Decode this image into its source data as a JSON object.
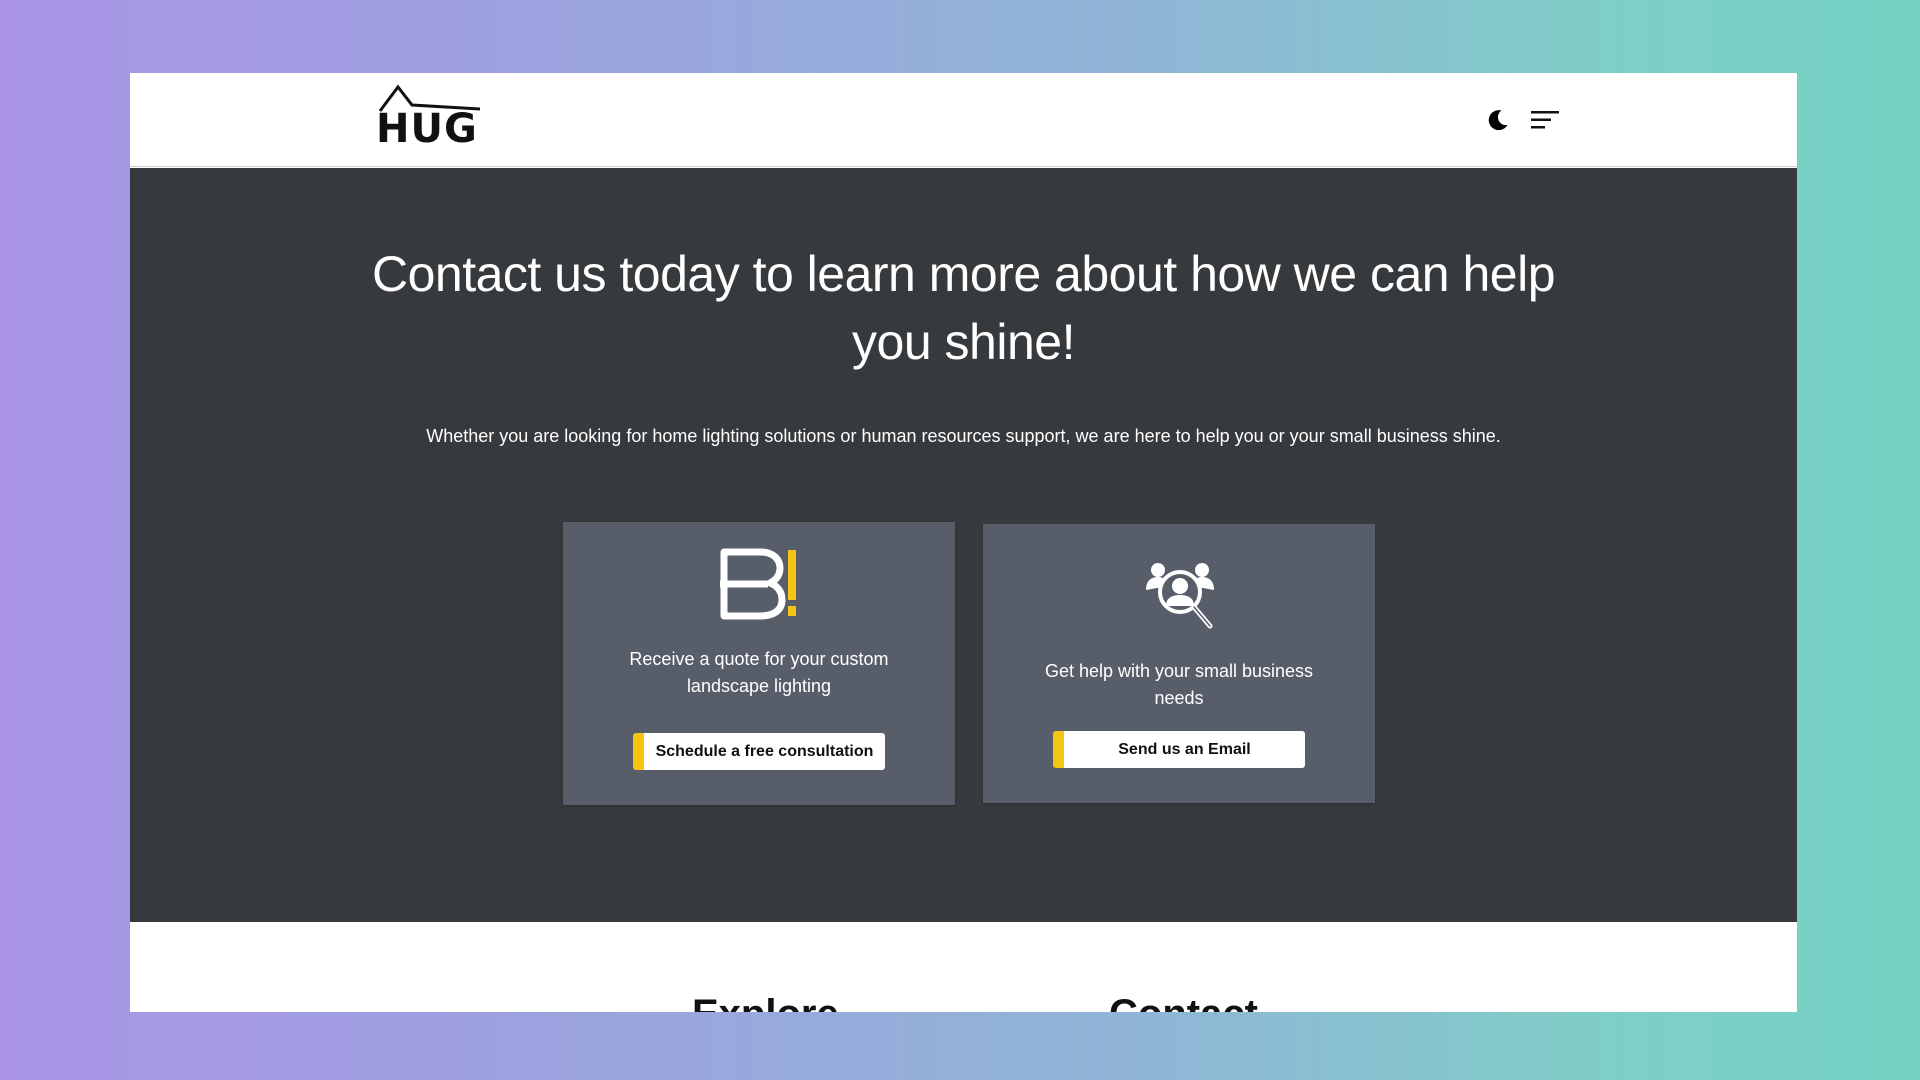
{
  "header": {
    "logo_text": "HUG",
    "theme_toggle_icon": "moon-icon",
    "menu_icon": "hamburger-menu-icon"
  },
  "hero": {
    "title": "Contact us today to learn more about how we can help you shine!",
    "subtitle": "Whether you are looking for home lighting solutions or human resources support, we are here to help you or your small business shine."
  },
  "cards": [
    {
      "icon": "bright-logo-icon",
      "text": "Receive a quote for your custom landscape lighting",
      "button_label": "Schedule a free consultation"
    },
    {
      "icon": "people-search-icon",
      "text": "Get help with your small business needs",
      "button_label": "Send us an Email"
    }
  ],
  "footer": {
    "headings": [
      "Explore",
      "Contact"
    ]
  },
  "colors": {
    "hero_bg": "#373a3d",
    "card_bg": "#575e6a",
    "accent_yellow": "#f4c614",
    "header_bg": "#ffffff"
  }
}
